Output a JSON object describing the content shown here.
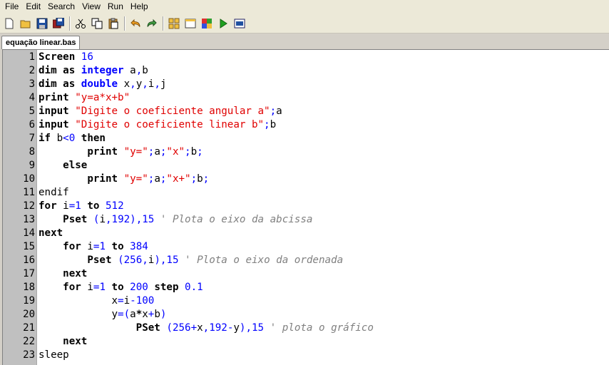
{
  "menu": [
    "File",
    "Edit",
    "Search",
    "View",
    "Run",
    "Help"
  ],
  "toolbar": {
    "icons": [
      "new-file-icon",
      "open-folder-icon",
      "save-icon",
      "save-all-icon",
      "cut-icon",
      "copy-icon",
      "paste-icon",
      "undo-icon",
      "redo-icon",
      "grid-icon",
      "window-icon",
      "color-palette-icon",
      "run-icon",
      "terminal-icon"
    ]
  },
  "tab": {
    "label": "equação linear.bas"
  },
  "colors": {
    "keyword": "#000000",
    "type": "#0000ff",
    "string": "#e00000",
    "number": "#0000ff",
    "comment": "#808080",
    "gutter": "#c0c0c0"
  },
  "code": [
    {
      "n": "1",
      "tokens": [
        {
          "t": "Screen",
          "c": "kw"
        },
        {
          "t": " ",
          "c": "id"
        },
        {
          "t": "16",
          "c": "nm"
        }
      ]
    },
    {
      "n": "2",
      "tokens": [
        {
          "t": "dim as ",
          "c": "kw"
        },
        {
          "t": "integer",
          "c": "ty"
        },
        {
          "t": " a",
          "c": "id"
        },
        {
          "t": ",",
          "c": "op"
        },
        {
          "t": "b",
          "c": "id"
        }
      ]
    },
    {
      "n": "3",
      "tokens": [
        {
          "t": "dim as ",
          "c": "kw"
        },
        {
          "t": "double",
          "c": "ty"
        },
        {
          "t": " x",
          "c": "id"
        },
        {
          "t": ",",
          "c": "op"
        },
        {
          "t": "y",
          "c": "id"
        },
        {
          "t": ",",
          "c": "op"
        },
        {
          "t": "i",
          "c": "id"
        },
        {
          "t": ",",
          "c": "op"
        },
        {
          "t": "j",
          "c": "id"
        }
      ]
    },
    {
      "n": "4",
      "tokens": [
        {
          "t": "print ",
          "c": "kw"
        },
        {
          "t": "\"y=a*x+b\"",
          "c": "st"
        }
      ]
    },
    {
      "n": "5",
      "tokens": [
        {
          "t": "input ",
          "c": "kw"
        },
        {
          "t": "\"Digite o coeficiente angular a\"",
          "c": "st"
        },
        {
          "t": ";",
          "c": "op"
        },
        {
          "t": "a",
          "c": "id"
        }
      ]
    },
    {
      "n": "6",
      "tokens": [
        {
          "t": "input ",
          "c": "kw"
        },
        {
          "t": "\"Digite o coeficiente linear b\"",
          "c": "st"
        },
        {
          "t": ";",
          "c": "op"
        },
        {
          "t": "b",
          "c": "id"
        }
      ]
    },
    {
      "n": "7",
      "tokens": [
        {
          "t": "if ",
          "c": "kw"
        },
        {
          "t": "b",
          "c": "id"
        },
        {
          "t": "<",
          "c": "op"
        },
        {
          "t": "0",
          "c": "nm"
        },
        {
          "t": " then",
          "c": "kw"
        }
      ]
    },
    {
      "n": "8",
      "tokens": [
        {
          "t": "        ",
          "c": "id"
        },
        {
          "t": "print ",
          "c": "kw"
        },
        {
          "t": "\"y=\"",
          "c": "st"
        },
        {
          "t": ";",
          "c": "op"
        },
        {
          "t": "a",
          "c": "id"
        },
        {
          "t": ";",
          "c": "op"
        },
        {
          "t": "\"x\"",
          "c": "st"
        },
        {
          "t": ";",
          "c": "op"
        },
        {
          "t": "b",
          "c": "id"
        },
        {
          "t": ";",
          "c": "op"
        }
      ]
    },
    {
      "n": "9",
      "tokens": [
        {
          "t": "    ",
          "c": "id"
        },
        {
          "t": "else",
          "c": "kw"
        }
      ]
    },
    {
      "n": "10",
      "tokens": [
        {
          "t": "        ",
          "c": "id"
        },
        {
          "t": "print ",
          "c": "kw"
        },
        {
          "t": "\"y=\"",
          "c": "st"
        },
        {
          "t": ";",
          "c": "op"
        },
        {
          "t": "a",
          "c": "id"
        },
        {
          "t": ";",
          "c": "op"
        },
        {
          "t": "\"x+\"",
          "c": "st"
        },
        {
          "t": ";",
          "c": "op"
        },
        {
          "t": "b",
          "c": "id"
        },
        {
          "t": ";",
          "c": "op"
        }
      ]
    },
    {
      "n": "11",
      "tokens": [
        {
          "t": "endif",
          "c": "id"
        }
      ]
    },
    {
      "n": "12",
      "tokens": [
        {
          "t": "for ",
          "c": "kw"
        },
        {
          "t": "i",
          "c": "id"
        },
        {
          "t": "=",
          "c": "op"
        },
        {
          "t": "1",
          "c": "nm"
        },
        {
          "t": " to ",
          "c": "kw"
        },
        {
          "t": "512",
          "c": "nm"
        }
      ]
    },
    {
      "n": "13",
      "tokens": [
        {
          "t": "    ",
          "c": "id"
        },
        {
          "t": "Pset ",
          "c": "kw"
        },
        {
          "t": "(",
          "c": "op"
        },
        {
          "t": "i",
          "c": "id"
        },
        {
          "t": ",",
          "c": "op"
        },
        {
          "t": "192",
          "c": "nm"
        },
        {
          "t": "),",
          "c": "op"
        },
        {
          "t": "15",
          "c": "nm"
        },
        {
          "t": " ' Plota o eixo da abcissa",
          "c": "cm"
        }
      ]
    },
    {
      "n": "14",
      "tokens": [
        {
          "t": "next",
          "c": "kw"
        }
      ]
    },
    {
      "n": "15",
      "tokens": [
        {
          "t": "    ",
          "c": "id"
        },
        {
          "t": "for ",
          "c": "kw"
        },
        {
          "t": "i",
          "c": "id"
        },
        {
          "t": "=",
          "c": "op"
        },
        {
          "t": "1",
          "c": "nm"
        },
        {
          "t": " to ",
          "c": "kw"
        },
        {
          "t": "384",
          "c": "nm"
        }
      ]
    },
    {
      "n": "16",
      "tokens": [
        {
          "t": "        ",
          "c": "id"
        },
        {
          "t": "Pset ",
          "c": "kw"
        },
        {
          "t": "(",
          "c": "op"
        },
        {
          "t": "256",
          "c": "nm"
        },
        {
          "t": ",",
          "c": "op"
        },
        {
          "t": "i",
          "c": "id"
        },
        {
          "t": "),",
          "c": "op"
        },
        {
          "t": "15",
          "c": "nm"
        },
        {
          "t": " ' Plota o eixo da ordenada",
          "c": "cm"
        }
      ]
    },
    {
      "n": "17",
      "tokens": [
        {
          "t": "    ",
          "c": "id"
        },
        {
          "t": "next",
          "c": "kw"
        }
      ]
    },
    {
      "n": "18",
      "tokens": [
        {
          "t": "    ",
          "c": "id"
        },
        {
          "t": "for ",
          "c": "kw"
        },
        {
          "t": "i",
          "c": "id"
        },
        {
          "t": "=",
          "c": "op"
        },
        {
          "t": "1",
          "c": "nm"
        },
        {
          "t": " to ",
          "c": "kw"
        },
        {
          "t": "200",
          "c": "nm"
        },
        {
          "t": " step ",
          "c": "kw"
        },
        {
          "t": "0.1",
          "c": "nm"
        }
      ]
    },
    {
      "n": "19",
      "tokens": [
        {
          "t": "            ",
          "c": "id"
        },
        {
          "t": "x",
          "c": "id"
        },
        {
          "t": "=",
          "c": "op"
        },
        {
          "t": "i",
          "c": "id"
        },
        {
          "t": "-",
          "c": "op"
        },
        {
          "t": "100",
          "c": "nm"
        }
      ]
    },
    {
      "n": "20",
      "tokens": [
        {
          "t": "            ",
          "c": "id"
        },
        {
          "t": "y",
          "c": "id"
        },
        {
          "t": "=(",
          "c": "op"
        },
        {
          "t": "a",
          "c": "id"
        },
        {
          "t": "*",
          "c": "kw"
        },
        {
          "t": "x",
          "c": "id"
        },
        {
          "t": "+",
          "c": "op"
        },
        {
          "t": "b",
          "c": "id"
        },
        {
          "t": ")",
          "c": "op"
        }
      ]
    },
    {
      "n": "21",
      "tokens": [
        {
          "t": "                ",
          "c": "id"
        },
        {
          "t": "PSet ",
          "c": "kw"
        },
        {
          "t": "(",
          "c": "op"
        },
        {
          "t": "256",
          "c": "nm"
        },
        {
          "t": "+",
          "c": "op"
        },
        {
          "t": "x",
          "c": "id"
        },
        {
          "t": ",",
          "c": "op"
        },
        {
          "t": "192",
          "c": "nm"
        },
        {
          "t": "-",
          "c": "op"
        },
        {
          "t": "y",
          "c": "id"
        },
        {
          "t": "),",
          "c": "op"
        },
        {
          "t": "15",
          "c": "nm"
        },
        {
          "t": " ' plota o gráfico",
          "c": "cm"
        }
      ]
    },
    {
      "n": "22",
      "tokens": [
        {
          "t": "    ",
          "c": "id"
        },
        {
          "t": "next",
          "c": "kw"
        }
      ]
    },
    {
      "n": "23",
      "tokens": [
        {
          "t": "sleep",
          "c": "id"
        }
      ]
    }
  ]
}
